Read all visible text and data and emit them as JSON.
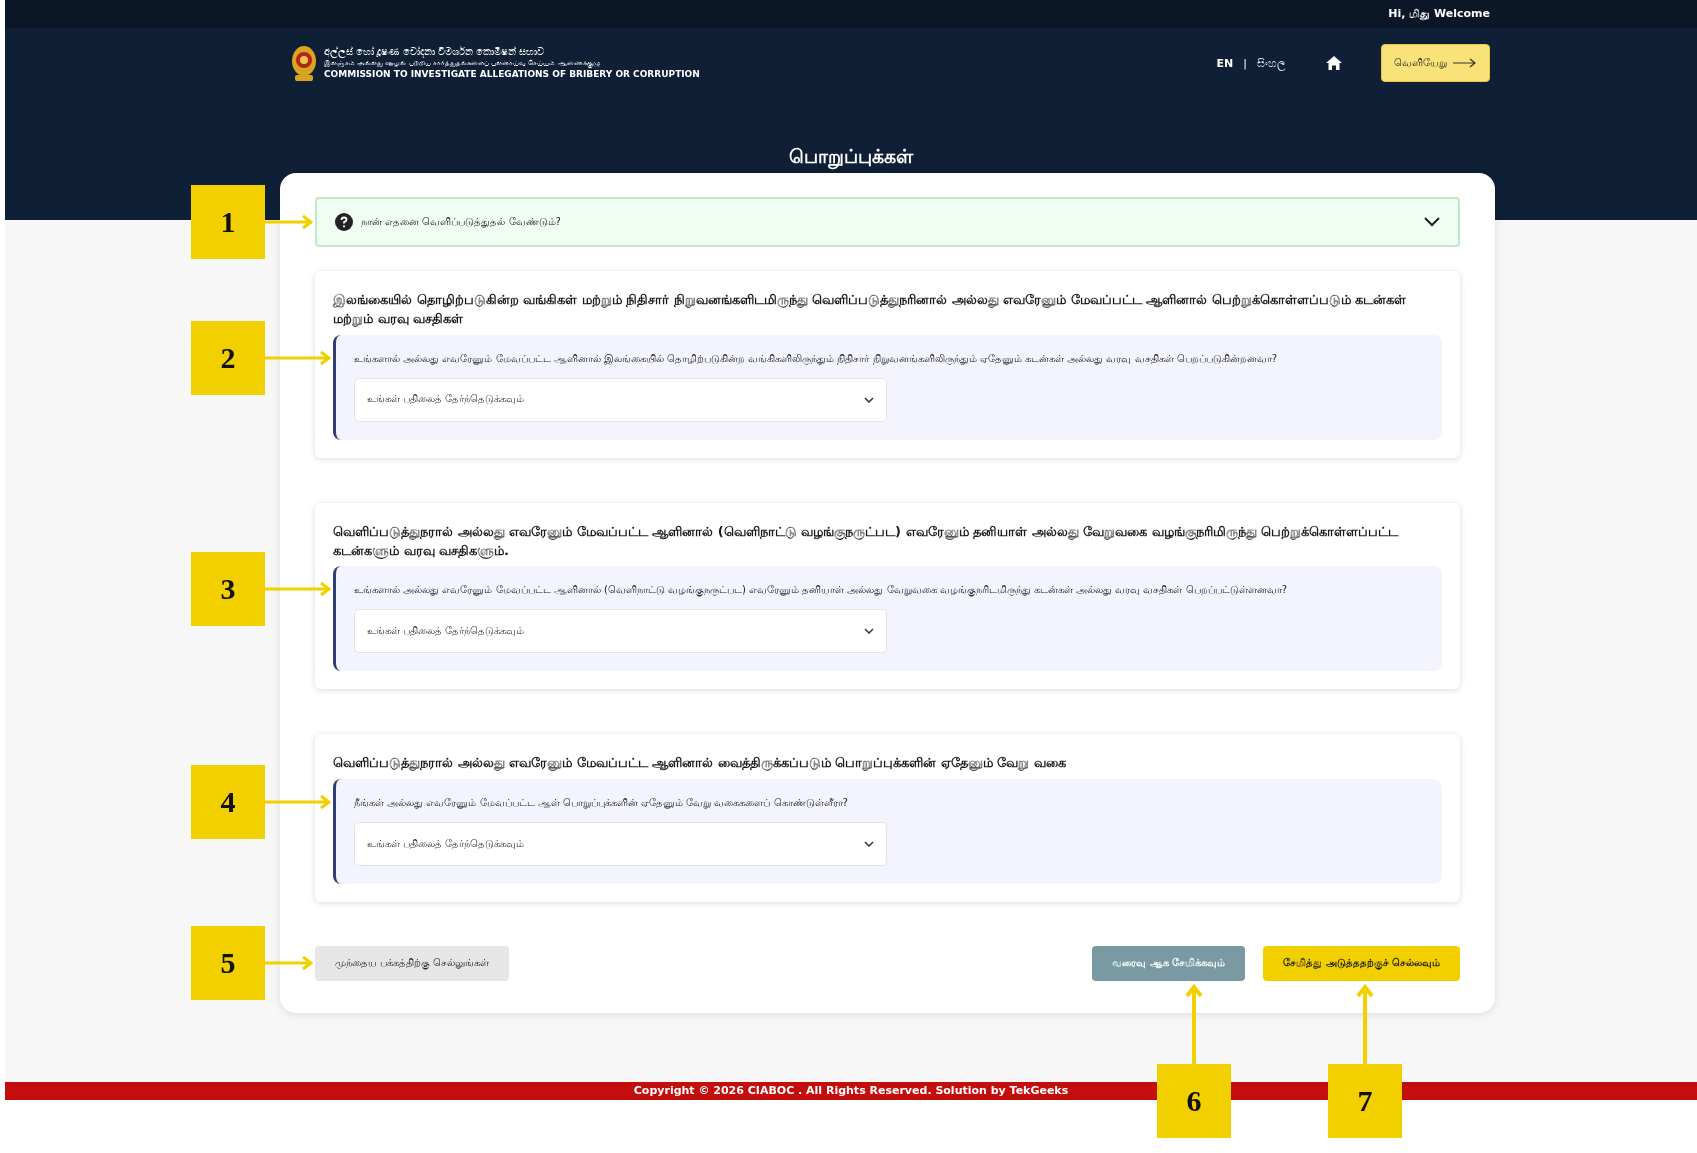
{
  "top_bar": {
    "greeting": "Hi, மிது Welcome"
  },
  "header": {
    "logo_lines": [
      "අල්ලස් හෝ දූෂණ චෝදනා විමර්ශන කොමිෂන් සභාව",
      "இலஞ்சம் அல்லது ஊழல் பற்றிய சார்த்துதல்களைப் புலனாய்வு செய்யும் ஆணைக்குழு",
      "COMMISSION TO INVESTIGATE ALLEGATIONS OF BRIBERY OR CORRUPTION"
    ],
    "languages": [
      {
        "label": "EN",
        "selected": true
      },
      {
        "label": "සිංහල",
        "selected": false
      }
    ],
    "separator": "|",
    "logout": "வெளியேறு"
  },
  "page_title": "பொறுப்புக்கள்",
  "help": {
    "question": "நான் எதனை வெளிப்படுத்துதல் வேண்டும்?",
    "expanded": false,
    "callout": "1"
  },
  "sections": [
    {
      "heading": "இலங்கையில் தொழிற்படுகின்ற வங்கிகள் மற்றும் நிதிசார் நிறுவனங்களிடமிருந்து வெளிப்படுத்துநரினால் அல்லது எவரேனும் மேவப்பட்ட ஆளினால் பெற்றுக்கொள்ளப்படும் கடன்கள் மற்றும் வரவு வசதிகள்",
      "question": "உங்களால் அல்லது எவரேனும் மேவப்பட்ட ஆளினால் இலங்கையில் தொழிற்படுகின்ற வங்கிகளிலிருந்தும் நிதிசார் நிறுவனங்களிலிருந்தும் ஏதேனும் கடன்கள் அல்லது வரவு வசதிகள் பெறப்படுகின்றனவா?",
      "placeholder": "உங்கள் பதிலைத் தேர்ந்தெடுக்கவும்",
      "callout": "2"
    },
    {
      "heading": "வெளிப்படுத்துநரால் அல்லது எவரேனும் மேவப்பட்ட ஆளினால் (வெளிநாட்டு வழங்குநருட்பட) எவரேனும் தனியாள் அல்லது வேறுவகை வழங்குநரிமிருந்து பெற்றுக்கொள்ளப்பட்ட கடன்களும் வரவு வசதிகளும்.",
      "question": "உங்களால் அல்லது எவரேனும் மேவப்பட்ட ஆளினால் (வெளிநாட்டு வழங்குநருட்பட) எவரேனும் தனியாள் அல்லது வேறுவகை வழங்குநரிடமிருந்து கடன்கள் அல்லது வரவு வசதிகள் பெறப்பட்டுள்ளனவா?",
      "placeholder": "உங்கள் பதிலைத் தேர்ந்தெடுக்கவும்",
      "callout": "3"
    },
    {
      "heading": "வெளிப்படுத்துநரால் அல்லது எவரேனும் மேவப்பட்ட ஆளினால் வைத்திருக்கப்படும் பொறுப்புக்களின் ஏதேனும் வேறு வகை",
      "question": "நீங்கள் அல்லது எவரேனும் மேவப்பட்ட ஆள் பொறுப்புக்களின் ஏதேனும் வேறு வகைகளைப் கொண்டுள்ளீரா?",
      "placeholder": "உங்கள் பதிலைத் தேர்ந்தெடுக்கவும்",
      "callout": "4"
    }
  ],
  "buttons": [
    {
      "kind": "back",
      "label": "முந்தைய பக்கத்திற்கு செல்லுங்கள்",
      "callout": "5"
    },
    {
      "kind": "draft",
      "label": "வரைவு ஆக சேமிக்கவும்",
      "callout": "6"
    },
    {
      "kind": "next",
      "label": "சேமித்து அடுத்ததற்குச் செல்லவும்",
      "callout": "7"
    }
  ],
  "footer": "Copyright © 2026 CIABOC . All Rights Reserved. Solution by TekGeeks"
}
